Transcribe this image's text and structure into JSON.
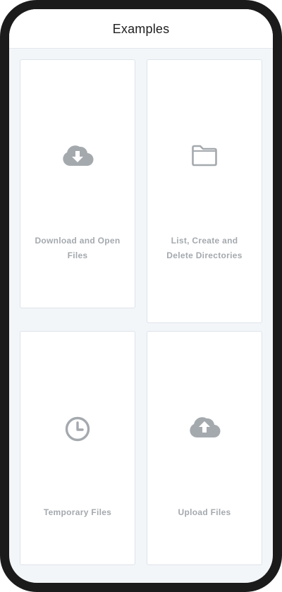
{
  "header": {
    "title": "Examples"
  },
  "cards": [
    {
      "label": "Download and Open Files",
      "icon": "cloud-download-icon"
    },
    {
      "label": "List, Create and Delete Directories",
      "icon": "folder-icon"
    },
    {
      "label": "Temporary Files",
      "icon": "clock-icon"
    },
    {
      "label": "Upload Files",
      "icon": "cloud-upload-icon"
    }
  ],
  "colors": {
    "frame": "#1b1b1b",
    "background": "#f3f6f9",
    "card": "#ffffff",
    "icon": "#a4a9ae",
    "label": "#a4a9ae",
    "title": "#1f1f1f"
  }
}
